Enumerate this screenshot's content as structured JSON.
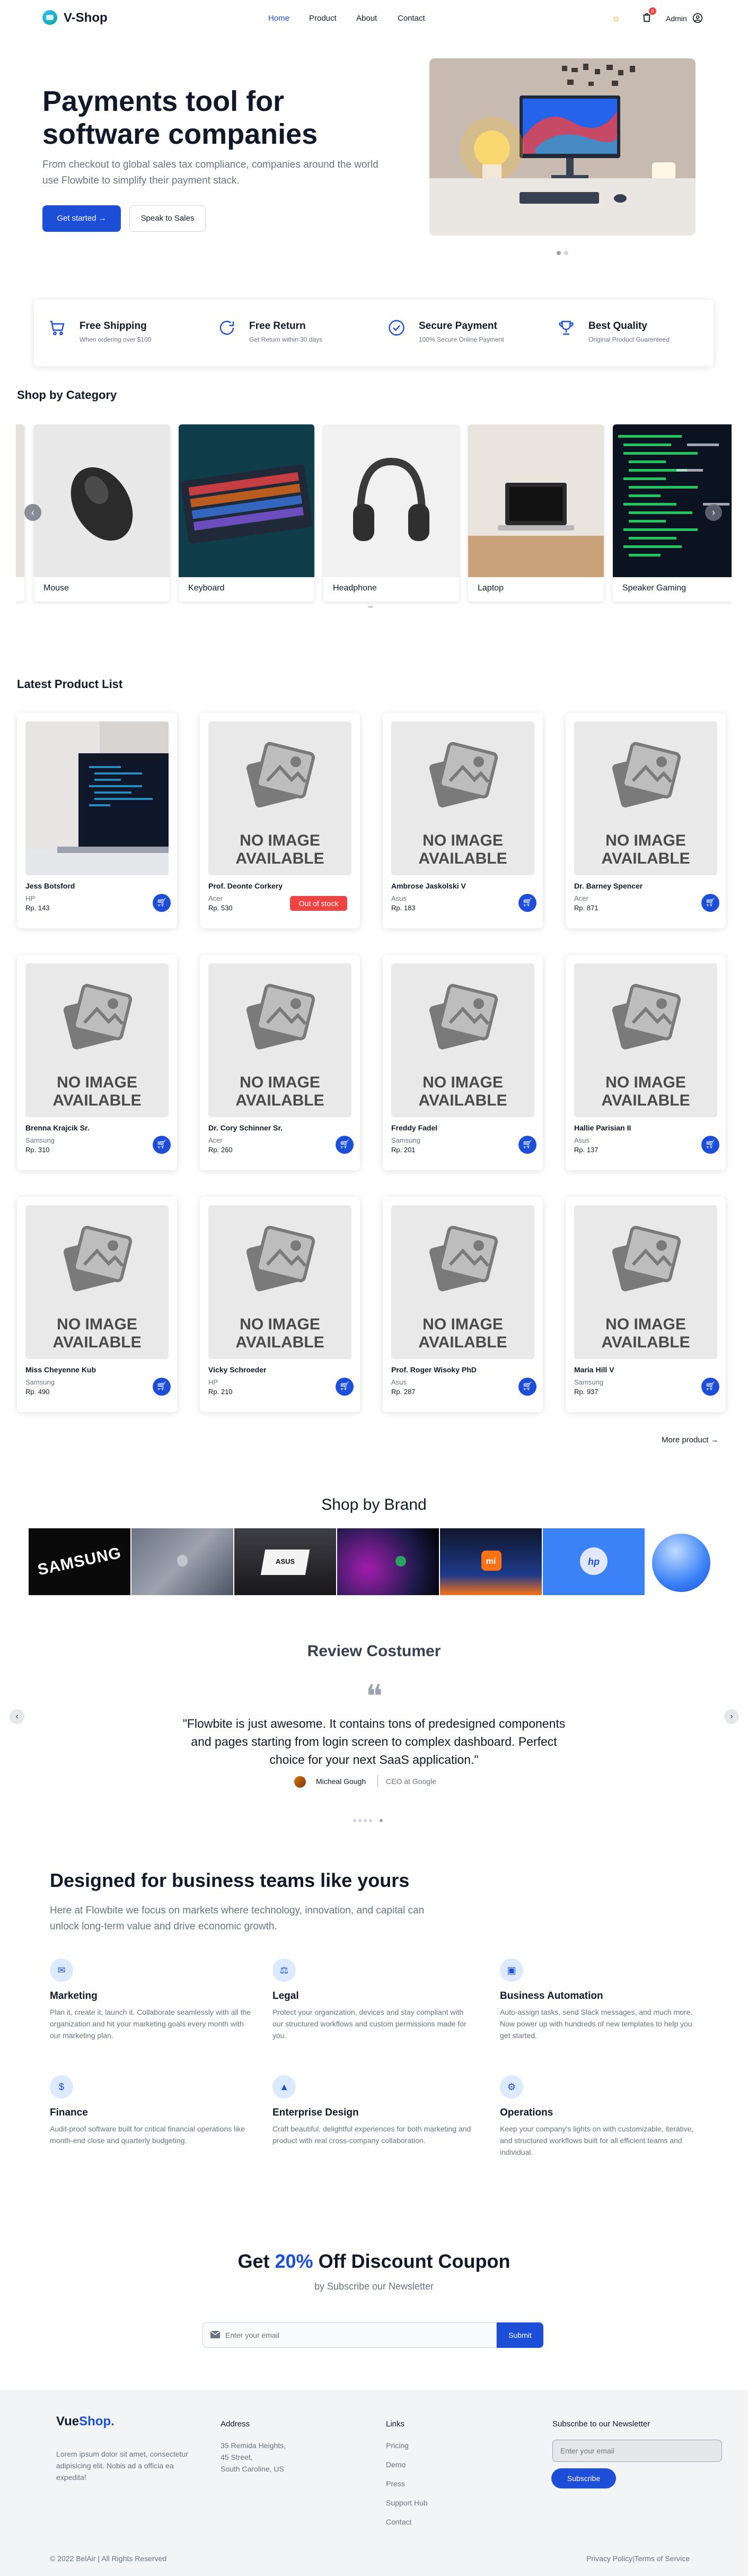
{
  "nav": {
    "brand": "V-Shop",
    "menu": [
      "Home",
      "Product",
      "About",
      "Contact"
    ],
    "cart_count": "0",
    "admin_label": "Admin"
  },
  "hero": {
    "title": "Payments tool for software companies",
    "subtitle": "From checkout to global sales tax compliance, companies around the world use Flowbite to simplify their payment stack.",
    "cta_primary": "Get started",
    "cta_secondary": "Speak to Sales"
  },
  "features": [
    {
      "icon": "truck-icon",
      "title": "Free Shipping",
      "desc": "When ordering over $100"
    },
    {
      "icon": "refresh-icon",
      "title": "Free Return",
      "desc": "Get Return within 30 days"
    },
    {
      "icon": "check-circle-icon",
      "title": "Secure Payment",
      "desc": "100% Secure Online Payment"
    },
    {
      "icon": "trophy-icon",
      "title": "Best Quality",
      "desc": "Original Product Guarenteed"
    }
  ],
  "category": {
    "title": "Shop by Category",
    "items": [
      "Mouse",
      "Keyboard",
      "Headphone",
      "Laptop",
      "Speaker Gaming"
    ]
  },
  "products": {
    "title": "Latest Product List",
    "items": [
      {
        "name": "Jess Botsford",
        "brand": "HP",
        "price": "Rp. 143",
        "stock": ""
      },
      {
        "name": "Prof. Deonte Corkery",
        "brand": "Acer",
        "price": "Rp. 530",
        "stock": "Out of stock"
      },
      {
        "name": "Ambrose Jaskolski V",
        "brand": "Asus",
        "price": "Rp. 183",
        "stock": ""
      },
      {
        "name": "Dr. Barney Spencer",
        "brand": "Acer",
        "price": "Rp. 871",
        "stock": ""
      },
      {
        "name": "Brenna Krajcik Sr.",
        "brand": "Samsung",
        "price": "Rp. 310",
        "stock": ""
      },
      {
        "name": "Dr. Cory Schinner Sr.",
        "brand": "Acer",
        "price": "Rp. 260",
        "stock": ""
      },
      {
        "name": "Freddy Fadel",
        "brand": "Samsung",
        "price": "Rp. 201",
        "stock": ""
      },
      {
        "name": "Hallie Parisian II",
        "brand": "Asus",
        "price": "Rp. 137",
        "stock": ""
      },
      {
        "name": "Miss Cheyenne Kub",
        "brand": "Samsung",
        "price": "Rp. 490",
        "stock": ""
      },
      {
        "name": "Vicky Schroeder",
        "brand": "HP",
        "price": "Rp. 210",
        "stock": ""
      },
      {
        "name": "Prof. Roger Wisoky PhD",
        "brand": "Asus",
        "price": "Rp. 287",
        "stock": ""
      },
      {
        "name": "Maria Hill V",
        "brand": "Samsung",
        "price": "Rp. 937",
        "stock": ""
      }
    ],
    "no_image_text": "NO IMAGE AVAILABLE",
    "more_label": "More product"
  },
  "brands": {
    "title": "Shop by Brand",
    "items": [
      "SAMSUNG",
      "",
      "ASUS",
      "",
      "mi",
      "hp",
      ""
    ]
  },
  "review": {
    "title": "Review Costumer",
    "quote": "\"Flowbite is just awesome. It contains tons of predesigned components and pages starting from login screen to complex dashboard. Perfect choice for your next SaaS application.\"",
    "author": "Micheal Gough",
    "role": "CEO at Google"
  },
  "business": {
    "title": "Designed for business teams like yours",
    "subtitle": "Here at Flowbite we focus on markets where technology, innovation, and capital can unlock long-term value and drive economic growth.",
    "items": [
      {
        "icon": "megaphone-icon",
        "title": "Marketing",
        "desc": "Plan it, create it, launch it. Collaborate seamlessly with all the organization and hit your marketing goals every month with our marketing plan."
      },
      {
        "icon": "scale-icon",
        "title": "Legal",
        "desc": "Protect your organization, devices and stay compliant with our structured workflows and custom permissions made for you."
      },
      {
        "icon": "briefcase-icon",
        "title": "Business Automation",
        "desc": "Auto-assign tasks, send Slack messages, and much more. Now power up with hundreds of new templates to help you get started."
      },
      {
        "icon": "dollar-icon",
        "title": "Finance",
        "desc": "Audit-proof software built for critical financial operations like month-end close and quarterly budgeting."
      },
      {
        "icon": "building-icon",
        "title": "Enterprise Design",
        "desc": "Craft beautiful, delightful experiences for both marketing and product with real cross-company collaboration."
      },
      {
        "icon": "gear-icon",
        "title": "Operations",
        "desc": "Keep your company's lights on with customizable, iterative, and structured workflows built for all efficient teams and individual."
      }
    ]
  },
  "coupon": {
    "title_pre": "Get ",
    "title_hl": "20%",
    "title_post": " Off Discount Coupon",
    "subtitle": "by Subscribe our Newsletter",
    "placeholder": "Enter your email",
    "button": "Submit"
  },
  "footer": {
    "brand_main": "Vue",
    "brand_hl": "Shop.",
    "desc": "Lorem ipsum dolor sit amet, consectetur adipisicing elit. Nobis ad a officia ea expedita!",
    "address_title": "Address",
    "address_lines": [
      "35 Remida Heights,",
      "45 Street,",
      "South Caroline, US"
    ],
    "links_title": "Links",
    "links": [
      "Pricing",
      "Demo",
      "Press",
      "Support Hub",
      "Contact"
    ],
    "newsletter_title": "Subscribe to our Newsletter",
    "newsletter_placeholder": "Enter your email",
    "newsletter_button": "Subscribe",
    "copyright": "© 2022 BelAir | All Rights Reserved",
    "legal": "Privacy Policy|Terms of Service"
  },
  "colors": {
    "accent": "#1d4ed8",
    "danger": "#ef4444"
  }
}
